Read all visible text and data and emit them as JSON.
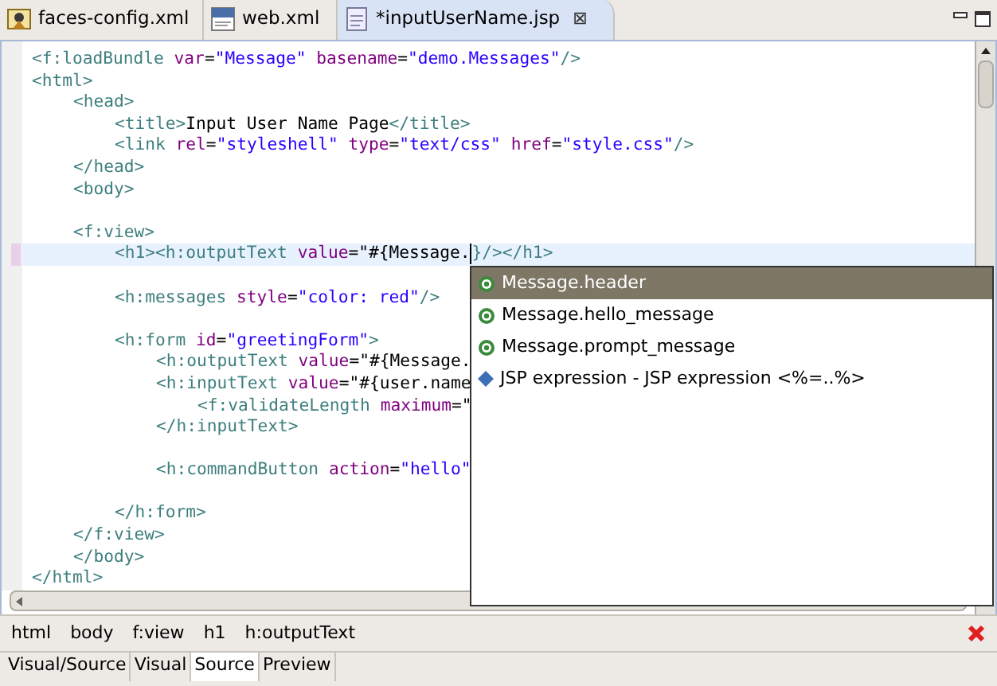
{
  "editor_tabs": [
    {
      "label": "faces-config.xml",
      "kind": "faces",
      "selected": false
    },
    {
      "label": "web.xml",
      "kind": "xml",
      "selected": false
    },
    {
      "label": "*inputUserName.jsp",
      "kind": "jsp",
      "selected": true,
      "close": "⊠"
    }
  ],
  "code_lines": [
    {
      "kind": "code",
      "tokens": [
        {
          "kind": "tag",
          "text": "<f:loadBundle "
        },
        {
          "kind": "attr",
          "text": "var"
        },
        {
          "kind": "plain",
          "text": "="
        },
        {
          "kind": "str",
          "text": "\"Message\" "
        },
        {
          "kind": "attr",
          "text": "basename"
        },
        {
          "kind": "plain",
          "text": "="
        },
        {
          "kind": "str",
          "text": "\"demo.Messages\""
        },
        {
          "kind": "tag",
          "text": "/>"
        }
      ]
    },
    {
      "kind": "code",
      "tokens": [
        {
          "kind": "tag",
          "text": "<html>"
        }
      ],
      "children": [
        {
          "kind": "code",
          "tokens": [
            {
              "kind": "tag",
              "text": "<head>"
            }
          ],
          "children": [
            {
              "kind": "code",
              "tokens": [
                {
                  "kind": "tag",
                  "text": "<title>"
                },
                {
                  "kind": "text",
                  "text": "Input User Name Page"
                },
                {
                  "kind": "tag",
                  "text": "</title>"
                }
              ]
            },
            {
              "kind": "code",
              "tokens": [
                {
                  "kind": "tag",
                  "text": "<link "
                },
                {
                  "kind": "attr",
                  "text": "rel"
                },
                {
                  "kind": "plain",
                  "text": "="
                },
                {
                  "kind": "str",
                  "text": "\"styleshell\" "
                },
                {
                  "kind": "attr",
                  "text": "type"
                },
                {
                  "kind": "plain",
                  "text": "="
                },
                {
                  "kind": "str",
                  "text": "\"text/css\" "
                },
                {
                  "kind": "attr",
                  "text": "href"
                },
                {
                  "kind": "plain",
                  "text": "="
                },
                {
                  "kind": "str",
                  "text": "\"style.css\""
                },
                {
                  "kind": "tag",
                  "text": "/>"
                }
              ]
            }
          ]
        },
        {
          "kind": "code",
          "tokens": [
            {
              "kind": "tag",
              "text": "</head>"
            }
          ]
        },
        {
          "kind": "code",
          "tokens": [
            {
              "kind": "tag",
              "text": "<body>"
            }
          ]
        },
        {
          "kind": "blank"
        },
        {
          "kind": "code",
          "tokens": [
            {
              "kind": "tag",
              "text": "<f:view>"
            }
          ],
          "children": [
            {
              "kind": "code",
              "current": true,
              "tokens": [
                {
                  "kind": "tag",
                  "text": "<h1><h:outputText "
                },
                {
                  "kind": "attr",
                  "text": "value"
                },
                {
                  "kind": "plain",
                  "text": "=\"#{Message."
                },
                {
                  "kind": "caret"
                },
                {
                  "kind": "tag",
                  "text": "}/></h1>"
                }
              ]
            },
            {
              "kind": "blank"
            },
            {
              "kind": "code",
              "tokens": [
                {
                  "kind": "tag",
                  "text": "<h:messages "
                },
                {
                  "kind": "attr",
                  "text": "style"
                },
                {
                  "kind": "plain",
                  "text": "="
                },
                {
                  "kind": "str",
                  "text": "\"color: red\""
                },
                {
                  "kind": "tag",
                  "text": "/>"
                }
              ]
            },
            {
              "kind": "blank"
            },
            {
              "kind": "code",
              "tokens": [
                {
                  "kind": "tag",
                  "text": "<h:form "
                },
                {
                  "kind": "attr",
                  "text": "id"
                },
                {
                  "kind": "plain",
                  "text": "="
                },
                {
                  "kind": "str",
                  "text": "\"greetingForm\""
                },
                {
                  "kind": "tag",
                  "text": ">"
                }
              ],
              "children": [
                {
                  "kind": "code",
                  "tokens": [
                    {
                      "kind": "tag",
                      "text": "<h:outputText "
                    },
                    {
                      "kind": "attr",
                      "text": "value"
                    },
                    {
                      "kind": "plain",
                      "text": "=\"#{Message."
                    }
                  ]
                },
                {
                  "kind": "code",
                  "tokens": [
                    {
                      "kind": "tag",
                      "text": "<h:inputText "
                    },
                    {
                      "kind": "attr",
                      "text": "value"
                    },
                    {
                      "kind": "plain",
                      "text": "=\"#{user.name"
                    }
                  ],
                  "children": [
                    {
                      "kind": "code",
                      "tokens": [
                        {
                          "kind": "tag",
                          "text": "<f:validateLength "
                        },
                        {
                          "kind": "attr",
                          "text": "maximum"
                        },
                        {
                          "kind": "plain",
                          "text": "=\""
                        }
                      ]
                    }
                  ]
                },
                {
                  "kind": "code",
                  "tokens": [
                    {
                      "kind": "tag",
                      "text": "</h:inputText>"
                    }
                  ]
                },
                {
                  "kind": "blank"
                },
                {
                  "kind": "code",
                  "tokens": [
                    {
                      "kind": "tag",
                      "text": "<h:commandButton "
                    },
                    {
                      "kind": "attr",
                      "text": "action"
                    },
                    {
                      "kind": "plain",
                      "text": "="
                    },
                    {
                      "kind": "str",
                      "text": "\"hello\""
                    }
                  ]
                },
                {
                  "kind": "blank"
                }
              ]
            },
            {
              "kind": "code",
              "tokens": [
                {
                  "kind": "tag",
                  "text": "</h:form>"
                }
              ]
            }
          ]
        },
        {
          "kind": "code",
          "tokens": [
            {
              "kind": "tag",
              "text": "</f:view>"
            }
          ]
        },
        {
          "kind": "code",
          "tokens": [
            {
              "kind": "tag",
              "text": "</body>"
            }
          ]
        }
      ]
    },
    {
      "kind": "code",
      "tokens": [
        {
          "kind": "tag",
          "text": "</html>"
        }
      ]
    }
  ],
  "completion": [
    {
      "label": "Message.header",
      "kind": "field",
      "selected": true
    },
    {
      "label": "Message.hello_message",
      "kind": "field",
      "selected": false
    },
    {
      "label": "Message.prompt_message",
      "kind": "field",
      "selected": false
    },
    {
      "label": "JSP expression - JSP expression <%=..%>",
      "kind": "template",
      "selected": false
    }
  ],
  "breadcrumb": [
    "html",
    "body",
    "f:view",
    "h1",
    "h:outputText"
  ],
  "view_tabs": [
    {
      "label": "Visual/Source",
      "selected": false
    },
    {
      "label": "Visual",
      "selected": false
    },
    {
      "label": "Source",
      "selected": true
    },
    {
      "label": "Preview",
      "selected": false
    }
  ]
}
